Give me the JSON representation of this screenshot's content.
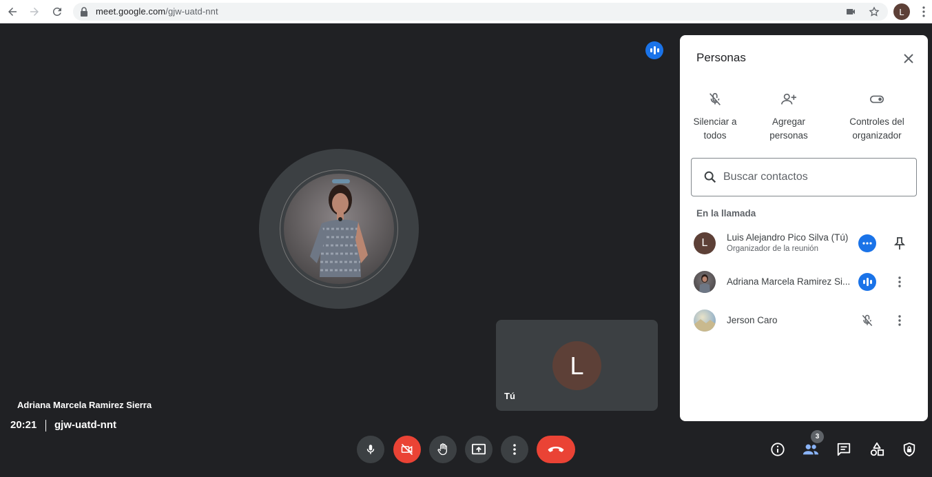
{
  "browser": {
    "url_host": "meet.google.com",
    "url_path": "/gjw-uatd-nnt",
    "profile_initial": "L"
  },
  "stage": {
    "speaker_name": "Adriana Marcela Ramirez Sierra",
    "self_initial": "L",
    "self_label": "Tú"
  },
  "bottom_bar": {
    "time": "20:21",
    "meeting_code": "gjw-uatd-nnt",
    "participants_count": "3"
  },
  "panel": {
    "title": "Personas",
    "actions": [
      {
        "line1": "Silenciar a",
        "line2": "todos"
      },
      {
        "line1": "Agregar",
        "line2": "personas"
      },
      {
        "line1": "Controles del",
        "line2": "organizador"
      }
    ],
    "search_placeholder": "Buscar contactos",
    "section_label": "En la llamada",
    "participants": [
      {
        "name": "Luis Alejandro Pico Silva (Tú)",
        "subtitle": "Organizador de la reunión",
        "initial": "L"
      },
      {
        "name": "Adriana Marcela Ramirez Si..."
      },
      {
        "name": "Jerson Caro"
      }
    ]
  },
  "colors": {
    "accent": "#1a73e8",
    "danger": "#ea4335",
    "stage_bg": "#202124",
    "tile_bg": "#3c4043",
    "avatar_brown": "#5d4037"
  }
}
